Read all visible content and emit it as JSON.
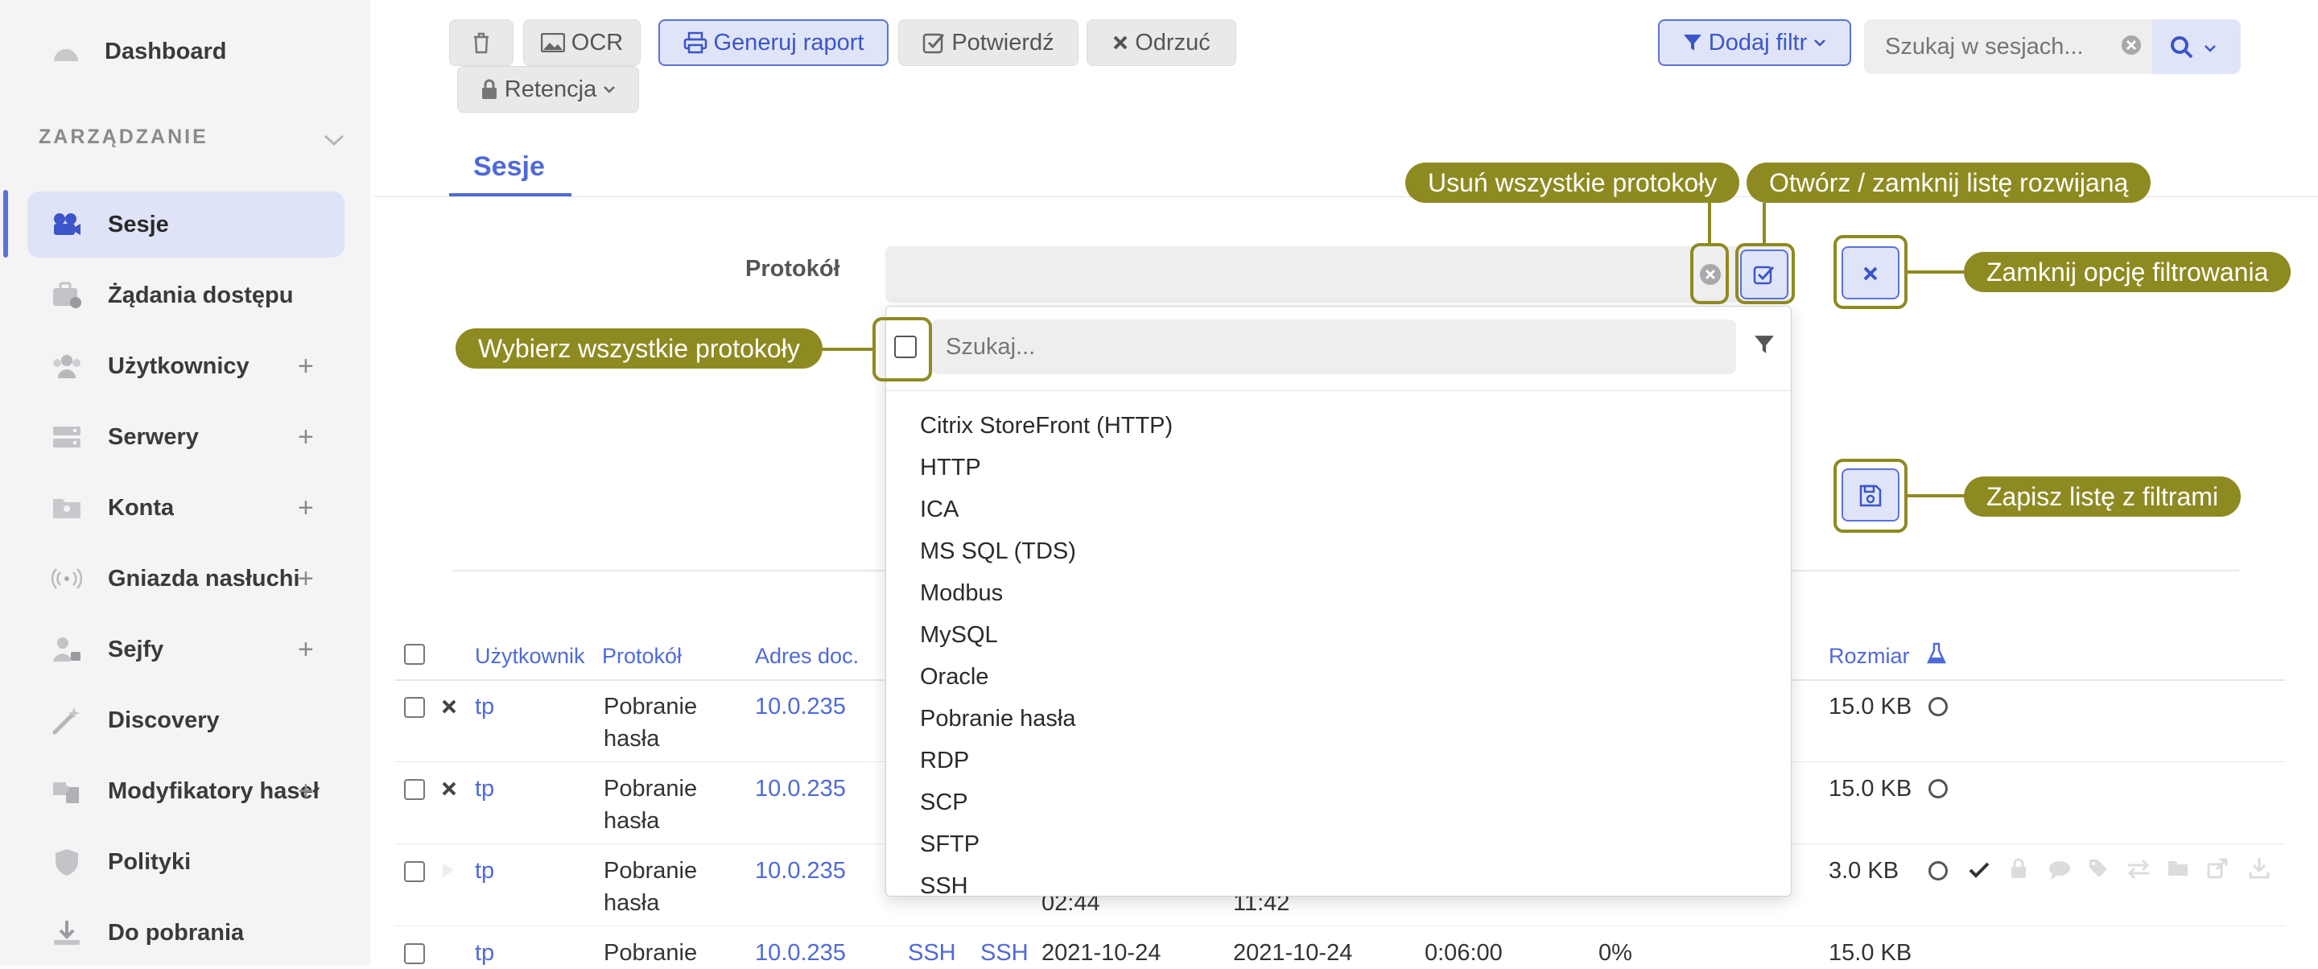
{
  "sidebar": {
    "dashboard": "Dashboard",
    "section_label": "ZARZĄDZANIE",
    "items": [
      {
        "label": "Sesje",
        "plus": ""
      },
      {
        "label": "Żądania dostępu",
        "plus": ""
      },
      {
        "label": "Użytkownicy",
        "plus": "+"
      },
      {
        "label": "Serwery",
        "plus": "+"
      },
      {
        "label": "Konta",
        "plus": "+"
      },
      {
        "label": "Gniazda nasłuchi...",
        "plus": "+"
      },
      {
        "label": "Sejfy",
        "plus": "+"
      },
      {
        "label": "Discovery",
        "plus": ""
      },
      {
        "label": "Modyfikatory haseł",
        "plus": "+"
      },
      {
        "label": "Polityki",
        "plus": ""
      },
      {
        "label": "Do pobrania",
        "plus": ""
      }
    ]
  },
  "toolbar": {
    "ocr": "OCR",
    "report": "Generuj raport",
    "confirm": "Potwierdź",
    "reject": "Odrzuć",
    "retention": "Retencja",
    "add_filter": "Dodaj filtr",
    "search_placeholder": "Szukaj w sesjach..."
  },
  "tabs": {
    "sessions": "Sesje"
  },
  "filter": {
    "label": "Protokół",
    "dropdown_search_placeholder": "Szukaj...",
    "options": [
      "Citrix StoreFront (HTTP)",
      "HTTP",
      "ICA",
      "MS SQL (TDS)",
      "Modbus",
      "MySQL",
      "Oracle",
      "Pobranie hasła",
      "RDP",
      "SCP",
      "SFTP",
      "SSH"
    ]
  },
  "annotations": {
    "remove_all": "Usuń wszystkie protokoły",
    "toggle_list": "Otwórz / zamknij listę rozwijaną",
    "close_filter": "Zamknij opcję filtrowania",
    "select_all": "Wybierz wszystkie protokoły",
    "save_list": "Zapisz listę z filtrami"
  },
  "table": {
    "headers": {
      "user": "Użytkownik",
      "protocol": "Protokół",
      "address": "Adres doc.",
      "size": "Rozmiar"
    },
    "rows": [
      {
        "user": "tp",
        "protocol_1": "Pobranie",
        "protocol_2": "hasła",
        "address": "10.0.235",
        "size": "15.0 KB",
        "c1": "",
        "c2": ""
      },
      {
        "user": "tp",
        "protocol_1": "Pobranie",
        "protocol_2": "hasła",
        "address": "10.0.235",
        "size": "15.0 KB",
        "c1": "",
        "c2": ""
      },
      {
        "user": "tp",
        "protocol_1": "Pobranie",
        "protocol_2": "hasła",
        "address": "10.0.235",
        "size": "3.0 KB",
        "c1": "02:44",
        "c2": "11:42"
      },
      {
        "user": "tp",
        "protocol_1": "Pobranie",
        "protocol_2": "",
        "address": "10.0.235",
        "size": "15.0 KB",
        "c1": "2021-10-24",
        "c2": "2021-10-24",
        "c3": "0:06:00",
        "c4": "0%",
        "ssh": "SSH",
        "ssh2": "SSH"
      }
    ]
  }
}
